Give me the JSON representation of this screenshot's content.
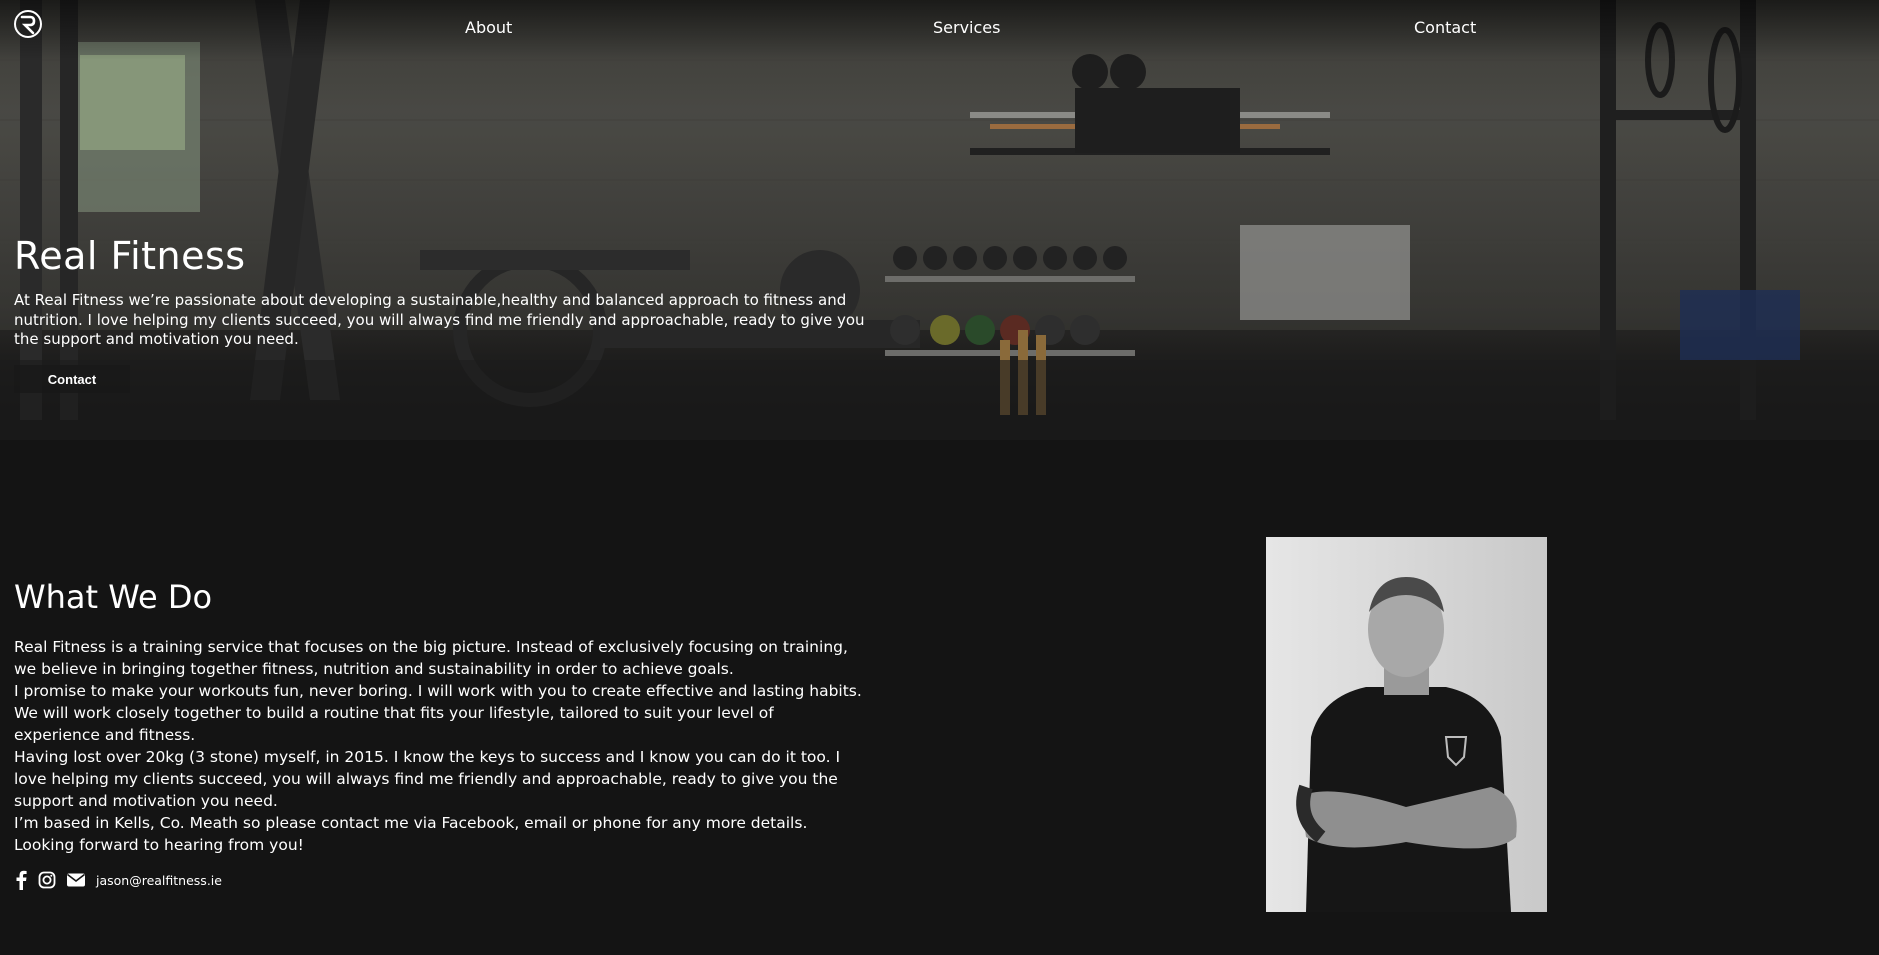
{
  "nav": {
    "links": [
      {
        "label": "About"
      },
      {
        "label": "Services"
      },
      {
        "label": "Contact"
      }
    ]
  },
  "hero": {
    "title": "Real Fitness",
    "text": "At Real Fitness we’re passionate about developing a sustainable,healthy and balanced approach to fitness and nutrition. I love helping my clients succeed, you will always find me friendly and approachable, ready to give you the support and motivation you need.",
    "button_label": "Contact"
  },
  "about": {
    "title": "What We Do",
    "paragraphs": [
      "Real Fitness is a training service that focuses on the big picture. Instead of exclusively focusing on training, we believe in bringing together fitness, nutrition and sustainability in order to achieve goals.",
      "I promise to make your workouts fun, never boring. I will work with you to create effective and lasting habits.",
      "We will work closely together to build a routine that fits your lifestyle, tailored to suit your level of experience and fitness.",
      "Having lost over 20kg (3 stone) myself, in 2015. I know the keys to success and I know you can do it too. I love helping my clients succeed, you will always find me friendly and approachable, ready to give you the support and motivation you need.",
      "I’m based in Kells, Co. Meath so please contact me via Facebook, email or phone for any more details.",
      "Looking forward to hearing from you!"
    ],
    "email": "jason@realfitness.ie"
  },
  "icons": {
    "logo": "logo-icon",
    "facebook": "facebook-icon",
    "instagram": "instagram-icon",
    "email": "envelope-icon"
  },
  "colors": {
    "background": "#141414",
    "text": "#ffffff",
    "button_bg": "#191919"
  }
}
